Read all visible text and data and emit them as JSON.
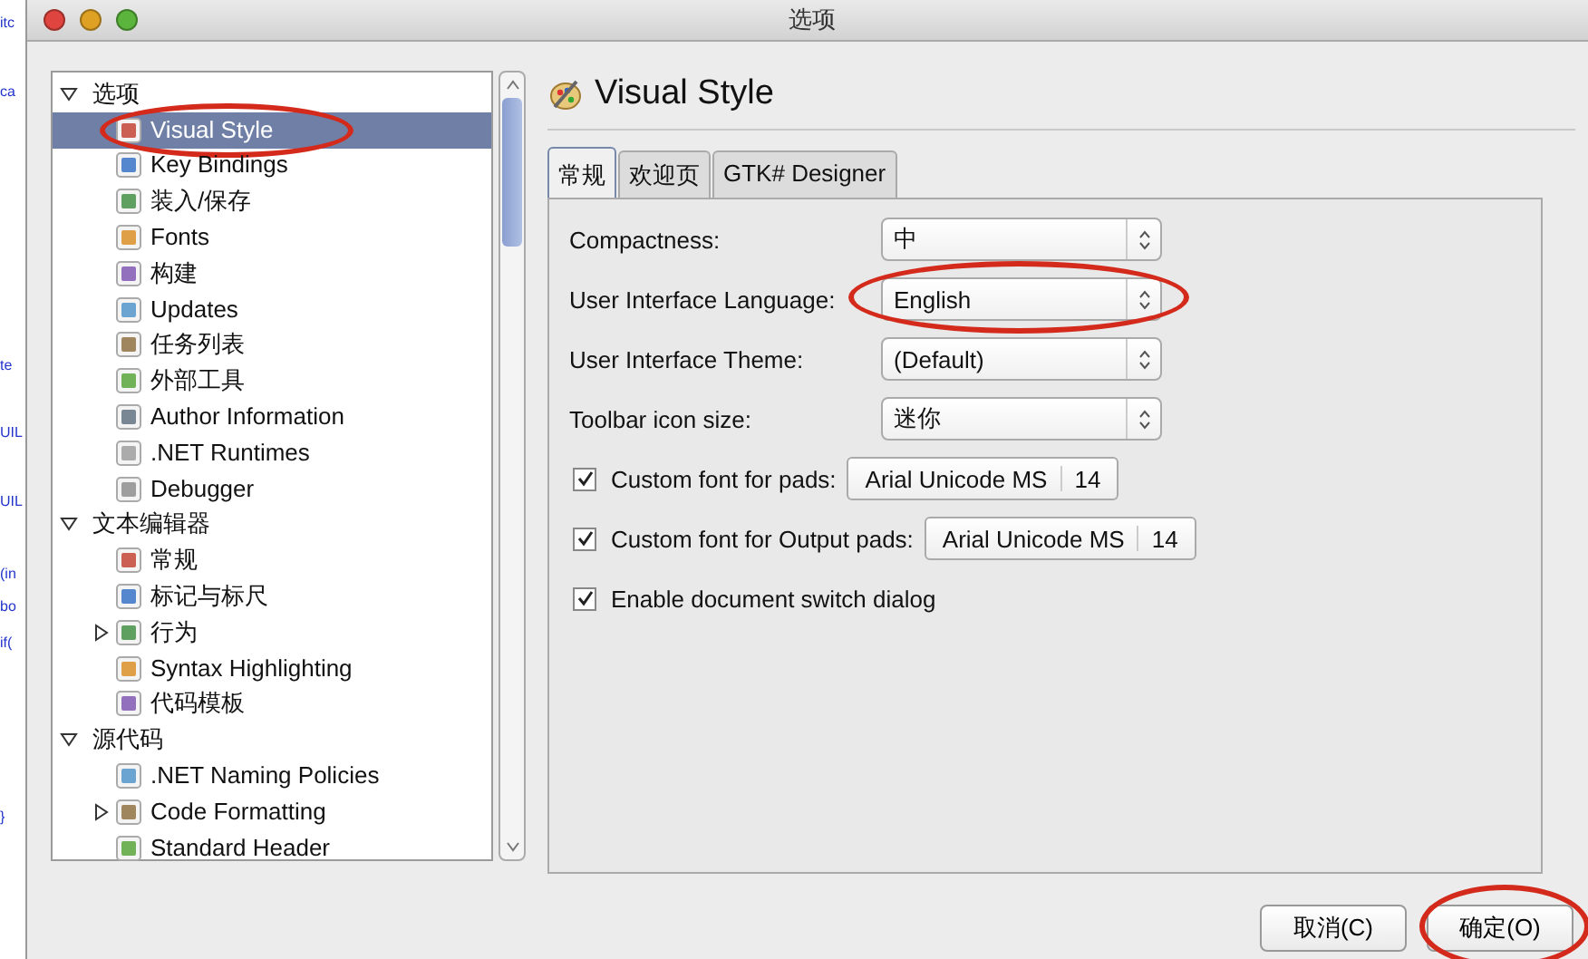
{
  "background_editor": {
    "fragments": [
      "itc",
      "ca",
      "te",
      "UIL",
      "UIL",
      "(in",
      "bo",
      "if(",
      "}"
    ]
  },
  "window": {
    "title": "选项"
  },
  "sidebar": {
    "tree": [
      {
        "label": "选项",
        "expanded": true,
        "children": [
          {
            "label": "Visual Style",
            "selected": true,
            "circled": true,
            "collapsed": false
          },
          {
            "label": "Key Bindings",
            "selected": false,
            "circled": false,
            "collapsed": false
          },
          {
            "label": "装入/保存",
            "selected": false,
            "circled": false,
            "collapsed": false
          },
          {
            "label": "Fonts",
            "selected": false,
            "circled": false,
            "collapsed": false
          },
          {
            "label": "构建",
            "selected": false,
            "circled": false,
            "collapsed": false
          },
          {
            "label": "Updates",
            "selected": false,
            "circled": false,
            "collapsed": false
          },
          {
            "label": "任务列表",
            "selected": false,
            "circled": false,
            "collapsed": false
          },
          {
            "label": "外部工具",
            "selected": false,
            "circled": false,
            "collapsed": false
          },
          {
            "label": "Author Information",
            "selected": false,
            "circled": false,
            "collapsed": false
          },
          {
            "label": ".NET Runtimes",
            "selected": false,
            "circled": false,
            "collapsed": false
          },
          {
            "label": "Debugger",
            "selected": false,
            "circled": false,
            "collapsed": false
          }
        ]
      },
      {
        "label": "文本编辑器",
        "expanded": true,
        "children": [
          {
            "label": "常规",
            "selected": false,
            "circled": false,
            "collapsed": false
          },
          {
            "label": "标记与标尺",
            "selected": false,
            "circled": false,
            "collapsed": false
          },
          {
            "label": "行为",
            "selected": false,
            "circled": false,
            "collapsed": true
          },
          {
            "label": "Syntax Highlighting",
            "selected": false,
            "circled": false,
            "collapsed": false
          },
          {
            "label": "代码模板",
            "selected": false,
            "circled": false,
            "collapsed": false
          }
        ]
      },
      {
        "label": "源代码",
        "expanded": true,
        "children": [
          {
            "label": ".NET Naming Policies",
            "selected": false,
            "circled": false,
            "collapsed": false
          },
          {
            "label": "Code Formatting",
            "selected": false,
            "circled": false,
            "collapsed": true
          },
          {
            "label": "Standard Header",
            "selected": false,
            "circled": false,
            "collapsed": false
          }
        ]
      }
    ]
  },
  "page": {
    "title": "Visual Style",
    "tabs": [
      {
        "label": "常规",
        "selected": true
      },
      {
        "label": "欢迎页",
        "selected": false
      },
      {
        "label": "GTK# Designer",
        "selected": false
      }
    ],
    "settings": [
      {
        "kind": "select",
        "label": "Compactness:",
        "value": "中",
        "circled": false
      },
      {
        "kind": "select",
        "label": "User Interface Language:",
        "value": "English",
        "circled": true
      },
      {
        "kind": "select",
        "label": "User Interface Theme:",
        "value": "(Default)",
        "circled": false
      },
      {
        "kind": "select",
        "label": "Toolbar icon size:",
        "value": "迷你",
        "circled": false
      },
      {
        "kind": "font",
        "label": "Custom font for pads:",
        "checked": true,
        "font": "Arial Unicode MS",
        "size": "14"
      },
      {
        "kind": "font",
        "label": "Custom font for Output pads:",
        "checked": true,
        "font": "Arial Unicode MS",
        "size": "14"
      },
      {
        "kind": "check",
        "label": "Enable document switch dialog",
        "checked": true
      }
    ]
  },
  "buttons": [
    {
      "label": "取消(C)",
      "circled": false
    },
    {
      "label": "确定(O)",
      "circled": true
    }
  ]
}
